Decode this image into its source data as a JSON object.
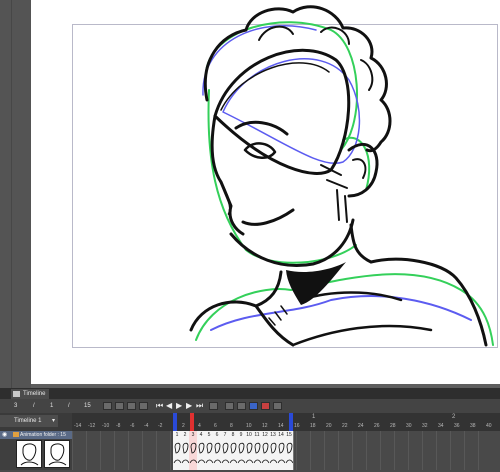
{
  "timeline_tab": {
    "label": "Timeline"
  },
  "toolbar": {
    "frame_current": "3",
    "slash1": "/",
    "frame_one": "1",
    "slash2": "/",
    "frame_total": "15"
  },
  "timeline_select": {
    "label": "Timeline 1"
  },
  "ruler": {
    "ticks": [
      "-14",
      "-12",
      "-10",
      "-8",
      "-6",
      "-4",
      "-2",
      "2",
      "4",
      "6",
      "8",
      "10",
      "12",
      "14",
      "16",
      "18",
      "20",
      "22",
      "24",
      "26",
      "28",
      "30",
      "32",
      "34",
      "36",
      "38",
      "40"
    ],
    "big_markers": [
      "1",
      "2"
    ]
  },
  "layer": {
    "name": "Animation folder : 15"
  },
  "cells": {
    "labels": [
      "1",
      "2",
      "3",
      "4",
      "5",
      "6",
      "7",
      "8",
      "9",
      "10",
      "11",
      "12",
      "13",
      "14",
      "15"
    ],
    "current_index": 2
  },
  "colors": {
    "start_marker": "#2a4ad8",
    "current_frame": "#e03030",
    "end_marker": "#2a4ad8",
    "ink": "#111111",
    "guide_green": "#34d05a",
    "guide_blue": "#5c5cf0"
  }
}
